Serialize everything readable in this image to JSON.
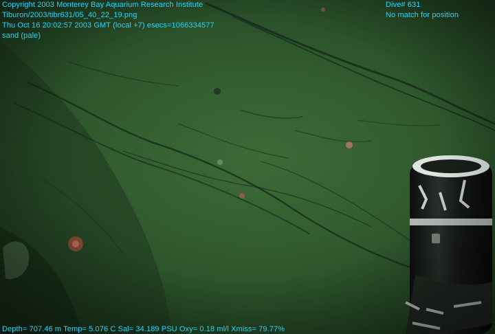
{
  "overlay": {
    "top_left": [
      "Copyright 2003 Monterey Bay Aquarium Research Institute",
      "Tiburon/2003/tibr631/05_40_22_19.png",
      "Thu Oct 16 20:02:57 2003 GMT (local +7)  esecs=1066334577",
      "sand (pale)"
    ],
    "top_right": [
      "Dive# 631",
      "No match for position"
    ],
    "bottom": "Depth= 707.46 m  Temp= 5.076 C  Sal= 34.189 PSU  Oxy= 0.18 ml/l  Xmiss= 79.77%"
  },
  "colors": {
    "overlay_text": "#22d7ff",
    "sediment": "#335e30"
  }
}
